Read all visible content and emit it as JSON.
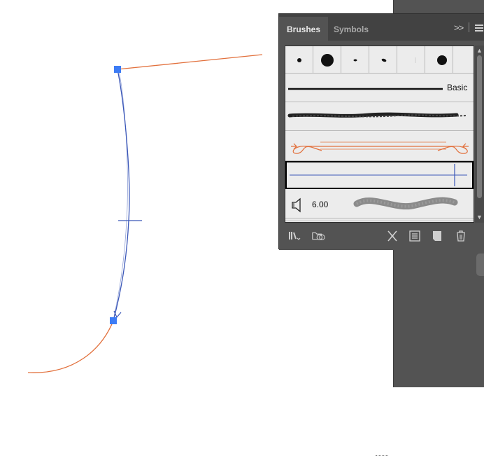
{
  "panel": {
    "tabs": [
      {
        "label": "Brushes",
        "active": true
      },
      {
        "label": "Symbols",
        "active": false
      }
    ],
    "collapse_glyph": ">>"
  },
  "brushes": {
    "calligraphic_tips": [
      "round-dot-small",
      "round-dot-large",
      "flat-nib-small",
      "angled-nib",
      "thin-line",
      "round-dot-medium"
    ],
    "basic_label": "Basic",
    "scatter_size": "6.00",
    "selected_row": "pattern-brush-blue"
  },
  "colors": {
    "path_orange": "#e2703c",
    "path_blue": "#3b57b8",
    "anchor_fill": "#3d7cf5",
    "selection_border": "#000000"
  },
  "footer": {
    "icons": [
      "brush-libraries-icon",
      "cc-libraries-icon",
      "remove-brush-stroke-icon",
      "brush-options-icon",
      "new-brush-icon",
      "delete-brush-icon"
    ]
  }
}
